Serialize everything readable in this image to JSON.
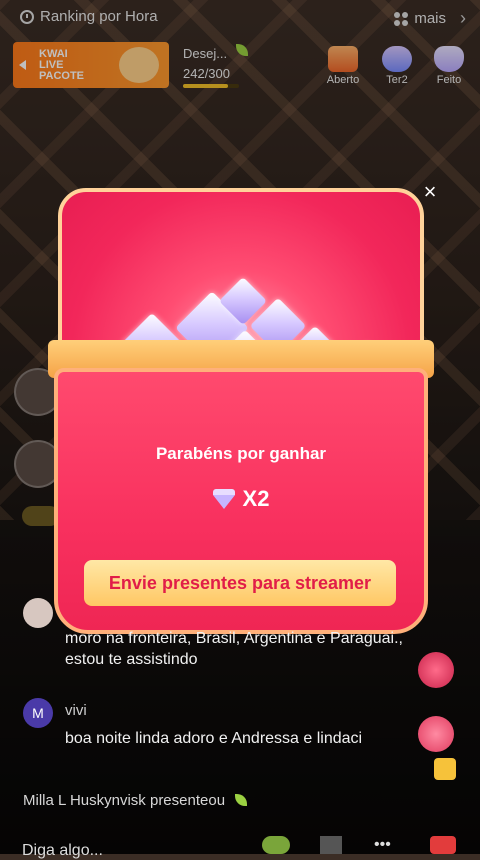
{
  "topbar": {
    "ranking_label": "Ranking por Hora",
    "more_label": "mais",
    "more_chevron": "›"
  },
  "promo": {
    "line1": "KWAI",
    "line2": "LIVE",
    "line3": "PACOTE"
  },
  "wish": {
    "label": "Desej...",
    "count": "242/300",
    "progress": 0.8067
  },
  "quick_items": [
    {
      "label": "Aberto",
      "icon": "gift-box-icon"
    },
    {
      "label": "Ter2",
      "icon": "cloud-icon"
    },
    {
      "label": "Feito",
      "icon": "bunny-icon"
    }
  ],
  "modal": {
    "close_glyph": "×",
    "congrats": "Parabéns por ganhar",
    "reward_icon": "diamond-icon",
    "reward_multiplier": "X2",
    "send_button": "Envie presentes para streamer"
  },
  "chat": {
    "messages": [
      {
        "name": "",
        "text": "moro na fronteira, Brasil, Argentina e Paraguai., estou te assistindo"
      },
      {
        "name": "vivi",
        "avatar_letter": "M",
        "text": "boa noite linda adoro e Andressa e lindaci"
      }
    ],
    "gift_notice": "Milla L Huskynvisk presenteou"
  },
  "input": {
    "placeholder": "Diga algo..."
  },
  "colors": {
    "accent": "#f2275a",
    "button_text": "#e11d48",
    "button_bg": "#ffc764",
    "progress": "#f3c128"
  }
}
